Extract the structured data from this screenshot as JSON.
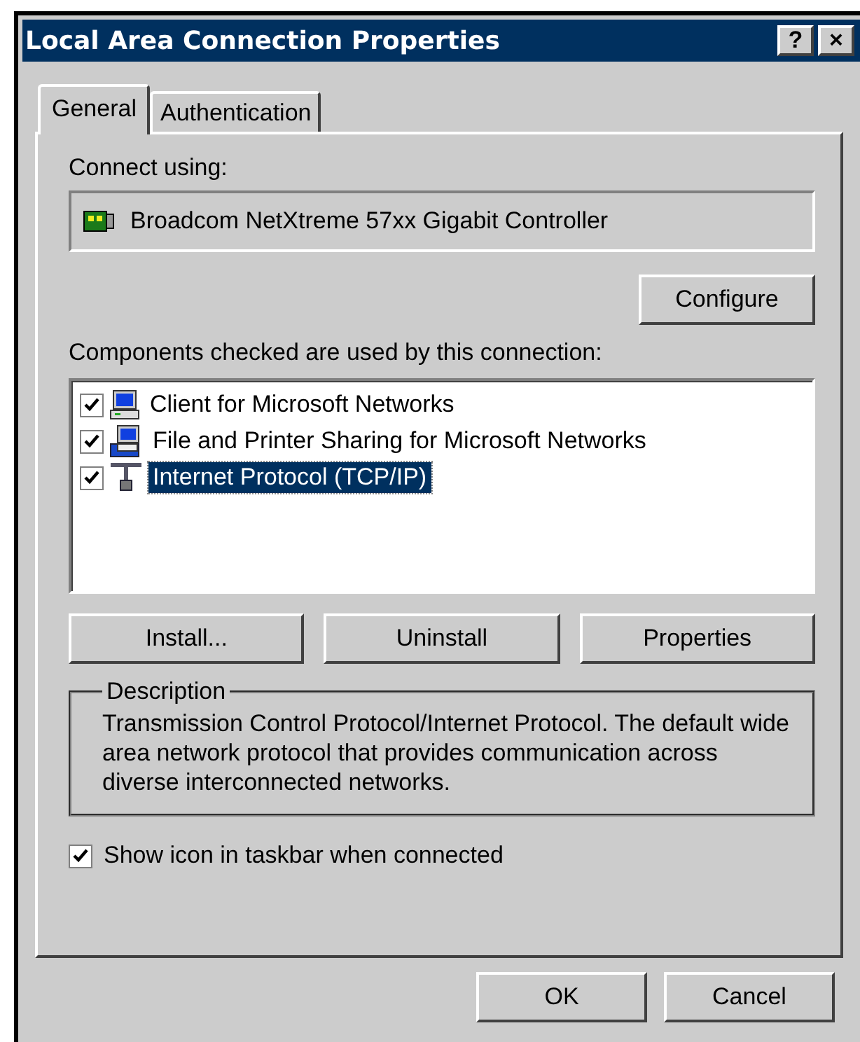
{
  "window": {
    "title": "Local Area Connection Properties",
    "title_buttons": [
      "?",
      "×"
    ]
  },
  "tabs": [
    {
      "label": "General",
      "selected": true
    },
    {
      "label": "Authentication",
      "selected": false
    }
  ],
  "connect_using": {
    "label": "Connect using:",
    "adapter": "Broadcom NetXtreme 57xx Gigabit Controller",
    "configure_button": "Configure"
  },
  "components": {
    "label": "Components checked are used by this connection:",
    "items": [
      {
        "name": "Client for Microsoft Networks",
        "kind": "client",
        "checked": true,
        "selected": false
      },
      {
        "name": "File and Printer Sharing for Microsoft Networks",
        "kind": "sharing",
        "checked": true,
        "selected": false
      },
      {
        "name": "Internet Protocol (TCP/IP)",
        "kind": "protocol",
        "checked": true,
        "selected": true
      }
    ],
    "buttons": [
      "Install...",
      "Uninstall",
      "Properties"
    ]
  },
  "description": {
    "title": "Description",
    "text": "Transmission Control Protocol/Internet Protocol. The default wide area network protocol that provides communication across diverse interconnected networks."
  },
  "show_icon": {
    "label": "Show icon in taskbar when connected",
    "checked": true
  },
  "dialog_buttons": [
    "OK",
    "Cancel"
  ]
}
